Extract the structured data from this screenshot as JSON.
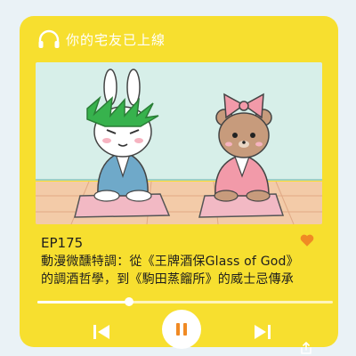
{
  "app": {
    "title": "你的宅友已上線",
    "accent_color": "#f7df2f",
    "heart_color": "#f08a24",
    "pause_color": "#f08a24"
  },
  "episode": {
    "number": "EP175",
    "title_line1": "動漫微醺特調：從《王牌酒保Glass of God》",
    "title_line2": "的調酒哲學，到《駒田蒸餾所》的威士忌傳承",
    "liked": true
  },
  "player": {
    "progress_fraction": 0.31,
    "state": "playing"
  },
  "icons": {
    "header": "headphones-icon",
    "like": "heart-icon",
    "prev": "skip-previous-icon",
    "pause": "pause-icon",
    "next": "skip-next-icon",
    "share": "share-icon"
  }
}
